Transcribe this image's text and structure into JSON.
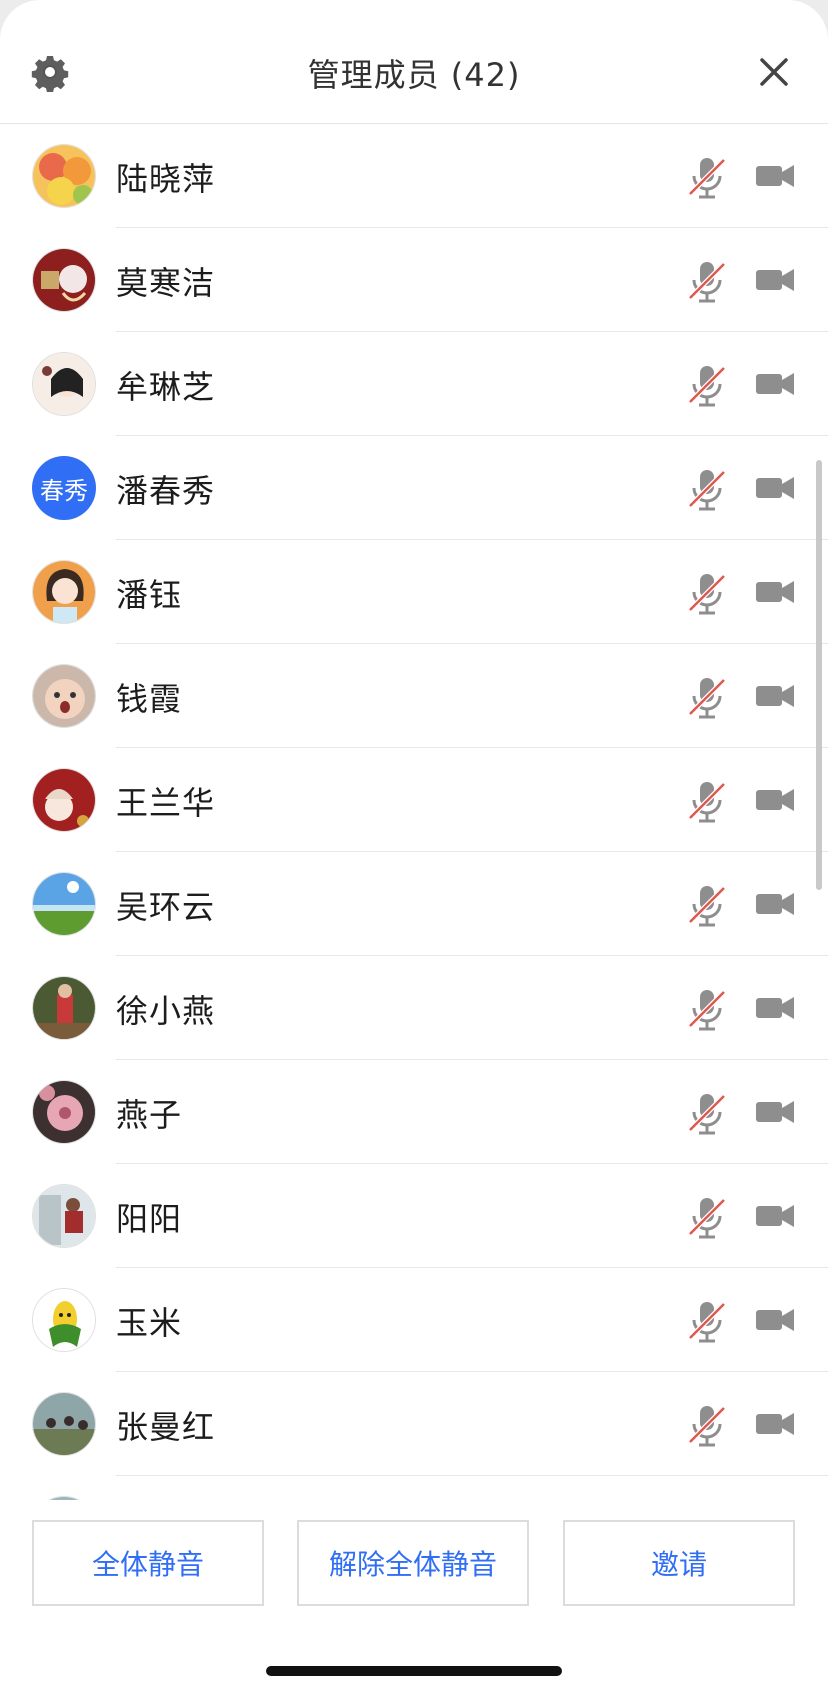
{
  "header": {
    "title": "管理成员 (42)",
    "settings_icon": "gear-icon",
    "close_icon": "close-icon"
  },
  "members": [
    {
      "name": "陆晓萍",
      "avatar": "fruit-photo"
    },
    {
      "name": "莫寒洁",
      "avatar": "illustration-red"
    },
    {
      "name": "牟琳芝",
      "avatar": "cartoon-girl"
    },
    {
      "name": "潘春秀",
      "avatar_text": "春秀"
    },
    {
      "name": "潘钰",
      "avatar": "cartoon-woman"
    },
    {
      "name": "钱霞",
      "avatar": "baby-photo"
    },
    {
      "name": "王兰华",
      "avatar": "illustration-red-2"
    },
    {
      "name": "吴环云",
      "avatar": "landscape"
    },
    {
      "name": "徐小燕",
      "avatar": "outdoor-person"
    },
    {
      "name": "燕子",
      "avatar": "flower"
    },
    {
      "name": "阳阳",
      "avatar": "person-outdoor"
    },
    {
      "name": "玉米",
      "avatar": "corn-cartoon"
    },
    {
      "name": "张曼红",
      "avatar": "group-outdoor"
    }
  ],
  "row_icons": {
    "mic": "microphone-muted-icon",
    "camera": "video-camera-icon"
  },
  "footer": {
    "mute_all": "全体静音",
    "unmute_all": "解除全体静音",
    "invite": "邀请"
  },
  "colors": {
    "accent": "#2f6ef5",
    "muted_slash": "#e0584f",
    "icon_gray": "#8e8e8e"
  }
}
